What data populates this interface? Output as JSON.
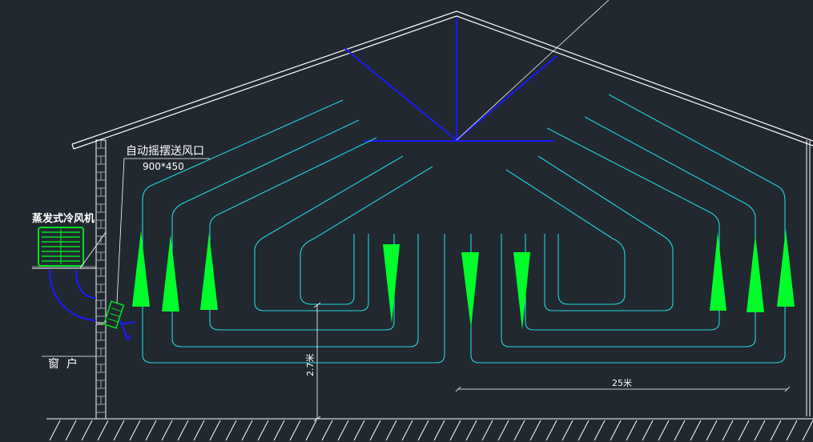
{
  "labels": {
    "cooler_name": "蒸发式冷风机",
    "outlet_name": "自动摇摆送风口",
    "outlet_size": "900*450",
    "window": "窗  户",
    "height_dim": "2.7米",
    "width_dim": "25米"
  },
  "colors": {
    "background": "#212830",
    "roof": "#ffffff",
    "truss": "#1a1aff",
    "airflow": "#22d6e0",
    "cone": "#00ff2a",
    "cooler": "#00e020",
    "text": "#ffffff"
  }
}
